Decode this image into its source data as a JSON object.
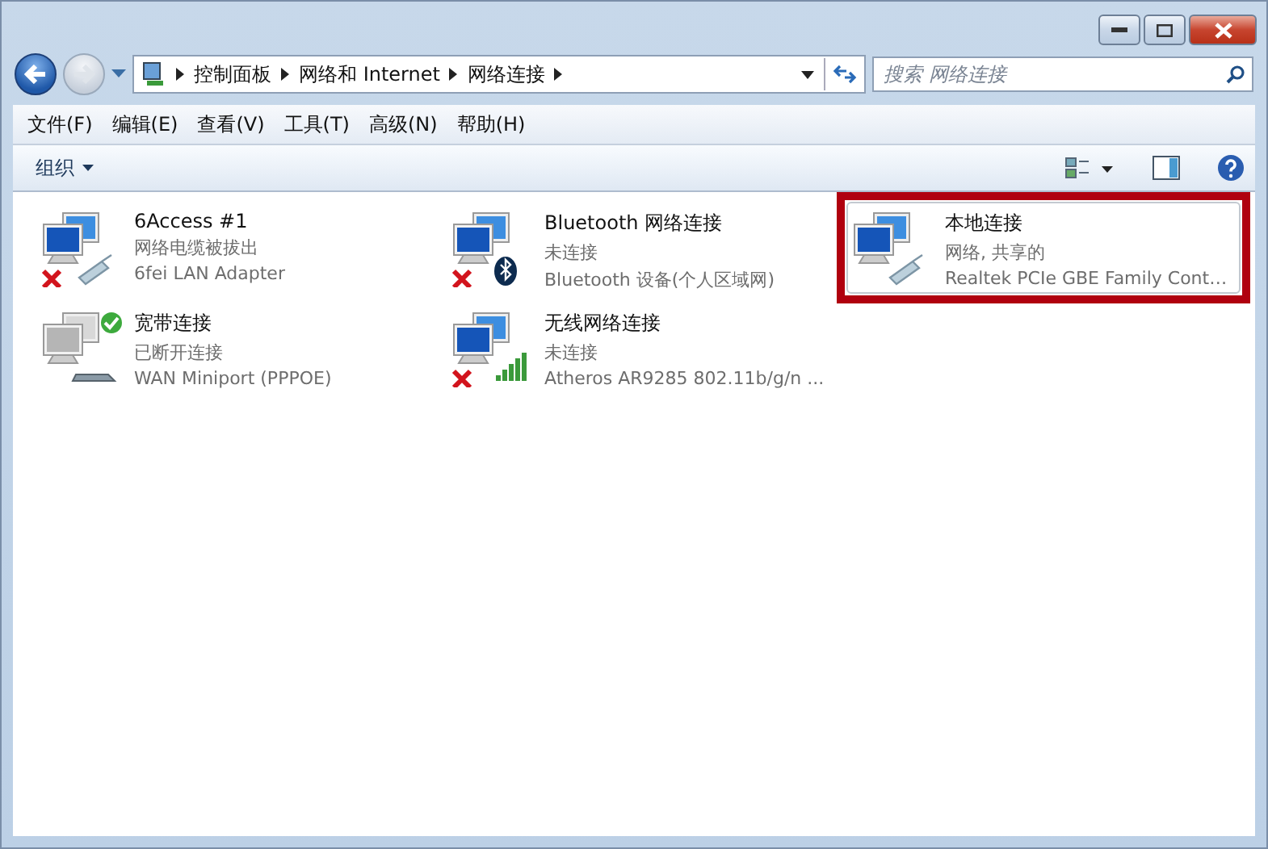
{
  "breadcrumb": [
    "控制面板",
    "网络和 Internet",
    "网络连接"
  ],
  "search": {
    "placeholder": "搜索 网络连接"
  },
  "menu": [
    "文件(F)",
    "编辑(E)",
    "查看(V)",
    "工具(T)",
    "高级(N)",
    "帮助(H)"
  ],
  "toolbar": {
    "organize": "组织"
  },
  "connections": [
    {
      "name": "6Access #1",
      "status": "网络电缆被拔出",
      "device": "6fei LAN Adapter",
      "kind": "unplugged",
      "adapter_icon": {
        "kind": "cable"
      },
      "selected": false,
      "highlighted": false
    },
    {
      "name": "Bluetooth 网络连接",
      "status": "未连接",
      "device": "Bluetooth 设备(个人区域网)",
      "kind": "unplugged",
      "adapter_icon": {
        "kind": "bluetooth"
      },
      "selected": false,
      "highlighted": false
    },
    {
      "name": "本地连接",
      "status": "网络, 共享的",
      "device": "Realtek PCIe GBE Family Cont…",
      "kind": "connected",
      "adapter_icon": {
        "kind": "cable"
      },
      "selected": true,
      "highlighted": true
    },
    {
      "name": "宽带连接",
      "status": "已断开连接",
      "device": "WAN Miniport (PPPOE)",
      "kind": "disconnected",
      "adapter_icon": {
        "kind": "modem"
      },
      "selected": false,
      "highlighted": false
    },
    {
      "name": "无线网络连接",
      "status": "未连接",
      "device": "Atheros AR9285 802.11b/g/n ...",
      "kind": "unplugged",
      "adapter_icon": {
        "kind": "wifi"
      },
      "selected": false,
      "highlighted": false
    }
  ]
}
